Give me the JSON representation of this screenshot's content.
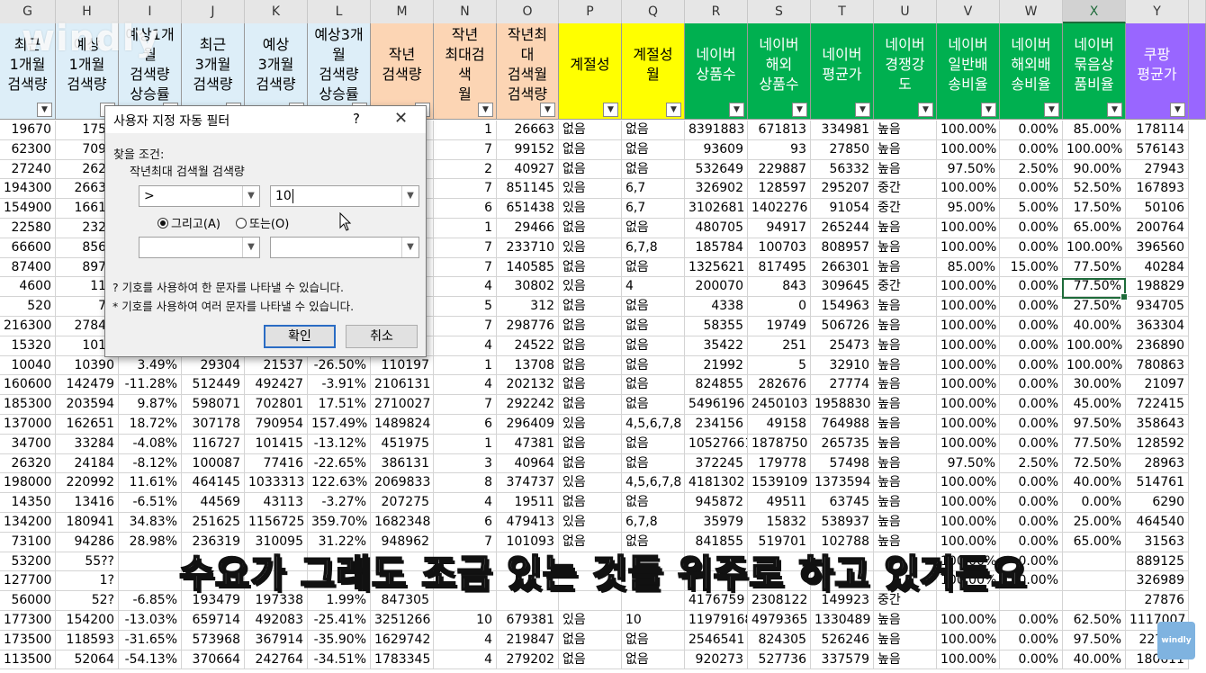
{
  "columns": [
    "G",
    "H",
    "I",
    "J",
    "K",
    "L",
    "M",
    "N",
    "O",
    "P",
    "Q",
    "R",
    "S",
    "T",
    "U",
    "V",
    "W",
    "X",
    "Y"
  ],
  "headers": [
    {
      "label": "최근\n1개월\n검색량",
      "color": "#ddeef8"
    },
    {
      "label": "예상\n1개월\n검색량",
      "color": "#ddeef8"
    },
    {
      "label": "예상1개월\n검색량\n상승률",
      "color": "#ddeef8"
    },
    {
      "label": "최근\n3개월\n검색량",
      "color": "#ddeef8"
    },
    {
      "label": "예상\n3개월\n검색량",
      "color": "#ddeef8"
    },
    {
      "label": "예상3개\n월\n검색량\n상승률",
      "color": "#ddeef8"
    },
    {
      "label": "작년\n검색량",
      "color": "#fcd5b4"
    },
    {
      "label": "작년\n최대검\n색\n월",
      "color": "#fcd5b4"
    },
    {
      "label": "작년최\n대\n검색월\n검색량",
      "color": "#fcd5b4"
    },
    {
      "label": "계절성",
      "color": "#ffff00"
    },
    {
      "label": "계절성\n월",
      "color": "#ffff00"
    },
    {
      "label": "네이버\n상품수",
      "color": "#00b050"
    },
    {
      "label": "네이버\n해외\n상품수",
      "color": "#00b050"
    },
    {
      "label": "네이버\n평균가",
      "color": "#00b050"
    },
    {
      "label": "네이버\n경쟁강\n도",
      "color": "#00b050"
    },
    {
      "label": "네이버\n일반배\n송비율",
      "color": "#00b050"
    },
    {
      "label": "네이버\n해외배\n송비율",
      "color": "#00b050"
    },
    {
      "label": "네이버\n묶음상\n품비율",
      "color": "#00b050"
    },
    {
      "label": "쿠팡\n평균가",
      "color": "#9966ff"
    }
  ],
  "rows": [
    [
      "19670",
      "1758",
      "",
      "",
      "",
      "",
      "",
      "1",
      "26663",
      "없음",
      "없음",
      "8391883",
      "671813",
      "334981",
      "높음",
      "100.00%",
      "0.00%",
      "85.00%",
      "178114"
    ],
    [
      "62300",
      "7098",
      "",
      "",
      "",
      "",
      "",
      "7",
      "99152",
      "없음",
      "없음",
      "93609",
      "93",
      "27850",
      "높음",
      "100.00%",
      "0.00%",
      "100.00%",
      "576143"
    ],
    [
      "27240",
      "2628",
      "",
      "",
      "",
      "",
      "",
      "2",
      "40927",
      "없음",
      "없음",
      "532649",
      "229887",
      "56332",
      "높음",
      "97.50%",
      "2.50%",
      "90.00%",
      "27943"
    ],
    [
      "194300",
      "26639",
      "",
      "",
      "",
      "",
      "",
      "7",
      "851145",
      "있음",
      "6,7",
      "326902",
      "128597",
      "295207",
      "중간",
      "100.00%",
      "0.00%",
      "52.50%",
      "167893"
    ],
    [
      "154900",
      "16613",
      "",
      "",
      "",
      "",
      "",
      "6",
      "651438",
      "있음",
      "6,7",
      "3102681",
      "1402276",
      "91054",
      "중간",
      "95.00%",
      "5.00%",
      "17.50%",
      "50106"
    ],
    [
      "22580",
      "2327",
      "",
      "",
      "",
      "",
      "",
      "1",
      "29466",
      "없음",
      "없음",
      "480705",
      "94917",
      "265244",
      "높음",
      "100.00%",
      "0.00%",
      "65.00%",
      "200764"
    ],
    [
      "66600",
      "8568",
      "",
      "",
      "",
      "",
      "",
      "7",
      "233710",
      "있음",
      "6,7,8",
      "185784",
      "100703",
      "808957",
      "높음",
      "100.00%",
      "0.00%",
      "100.00%",
      "396560"
    ],
    [
      "87400",
      "8976",
      "",
      "",
      "",
      "",
      "",
      "7",
      "140585",
      "없음",
      "없음",
      "1325621",
      "817495",
      "266301",
      "높음",
      "85.00%",
      "15.00%",
      "77.50%",
      "40284"
    ],
    [
      "4600",
      "114",
      "",
      "",
      "",
      "",
      "",
      "4",
      "30802",
      "있음",
      "4",
      "200070",
      "843",
      "309645",
      "중간",
      "100.00%",
      "0.00%",
      "77.50%",
      "198829"
    ],
    [
      "520",
      "72",
      "",
      "",
      "",
      "",
      "",
      "5",
      "312",
      "없음",
      "없음",
      "4338",
      "0",
      "154963",
      "높음",
      "100.00%",
      "0.00%",
      "27.50%",
      "934705"
    ],
    [
      "216300",
      "27842",
      "",
      "",
      "",
      "",
      "",
      "7",
      "298776",
      "없음",
      "없음",
      "58355",
      "19749",
      "506726",
      "높음",
      "100.00%",
      "0.00%",
      "40.00%",
      "363304"
    ],
    [
      "15320",
      "1017",
      "",
      "",
      "",
      "",
      "",
      "4",
      "24522",
      "없음",
      "없음",
      "35422",
      "251",
      "25473",
      "높음",
      "100.00%",
      "0.00%",
      "100.00%",
      "236890"
    ],
    [
      "10040",
      "10390",
      "3.49%",
      "29304",
      "21537",
      "-26.50%",
      "110197",
      "1",
      "13708",
      "없음",
      "없음",
      "21992",
      "5",
      "32910",
      "높음",
      "100.00%",
      "0.00%",
      "100.00%",
      "780863"
    ],
    [
      "160600",
      "142479",
      "-11.28%",
      "512449",
      "492427",
      "-3.91%",
      "2106131",
      "4",
      "202132",
      "없음",
      "없음",
      "824855",
      "282676",
      "27774",
      "높음",
      "100.00%",
      "0.00%",
      "30.00%",
      "21097"
    ],
    [
      "185300",
      "203594",
      "9.87%",
      "598071",
      "702801",
      "17.51%",
      "2710027",
      "7",
      "292242",
      "없음",
      "없음",
      "5496196",
      "2450103",
      "1958830",
      "높음",
      "100.00%",
      "0.00%",
      "45.00%",
      "722415"
    ],
    [
      "137000",
      "162651",
      "18.72%",
      "307178",
      "790954",
      "157.49%",
      "1489824",
      "6",
      "296409",
      "있음",
      "4,5,6,7,8",
      "234156",
      "49158",
      "764988",
      "높음",
      "100.00%",
      "0.00%",
      "97.50%",
      "358643"
    ],
    [
      "34700",
      "33284",
      "-4.08%",
      "116727",
      "101415",
      "-13.12%",
      "451975",
      "1",
      "47381",
      "없음",
      "없음",
      "10527661",
      "1878750",
      "265735",
      "높음",
      "100.00%",
      "0.00%",
      "77.50%",
      "128592"
    ],
    [
      "26320",
      "24184",
      "-8.12%",
      "100087",
      "77416",
      "-22.65%",
      "386131",
      "3",
      "40964",
      "없음",
      "없음",
      "372245",
      "179778",
      "57498",
      "높음",
      "97.50%",
      "2.50%",
      "72.50%",
      "28963"
    ],
    [
      "198000",
      "220992",
      "11.61%",
      "464145",
      "1033313",
      "122.63%",
      "2069833",
      "8",
      "374737",
      "있음",
      "4,5,6,7,8",
      "4181302",
      "1539109",
      "1373594",
      "높음",
      "100.00%",
      "0.00%",
      "40.00%",
      "514761"
    ],
    [
      "14350",
      "13416",
      "-6.51%",
      "44569",
      "43113",
      "-3.27%",
      "207275",
      "4",
      "19511",
      "없음",
      "없음",
      "945872",
      "49511",
      "63745",
      "높음",
      "100.00%",
      "0.00%",
      "0.00%",
      "6290"
    ],
    [
      "134200",
      "180941",
      "34.83%",
      "251625",
      "1156725",
      "359.70%",
      "1682348",
      "6",
      "479413",
      "있음",
      "6,7,8",
      "35979",
      "15832",
      "538937",
      "높음",
      "100.00%",
      "0.00%",
      "25.00%",
      "464540"
    ],
    [
      "73100",
      "94286",
      "28.98%",
      "236319",
      "310095",
      "31.22%",
      "948962",
      "7",
      "101093",
      "없음",
      "없음",
      "841855",
      "519701",
      "102788",
      "높음",
      "100.00%",
      "0.00%",
      "65.00%",
      "31563"
    ],
    [
      "53200",
      "55??",
      "",
      "",
      "",
      "",
      "",
      "",
      "",
      "",
      "",
      "",
      "",
      "",
      "",
      "100.00%",
      "0.00%",
      "",
      "889125"
    ],
    [
      "127700",
      "1?",
      "",
      "57",
      "",
      "",
      "",
      "",
      "",
      "",
      "",
      "",
      "",
      "",
      "",
      "100.00%",
      "0.00%",
      "",
      "326989"
    ],
    [
      "56000",
      "52?",
      "-6.85%",
      "193479",
      "197338",
      "1.99%",
      "847305",
      "",
      "",
      "",
      "",
      "4176759",
      "2308122",
      "149923",
      "중간",
      "",
      "",
      "",
      "27876"
    ],
    [
      "177300",
      "154200",
      "-13.03%",
      "659714",
      "492083",
      "-25.41%",
      "3251266",
      "10",
      "679381",
      "있음",
      "10",
      "11979168",
      "4979365",
      "1330489",
      "높음",
      "100.00%",
      "0.00%",
      "62.50%",
      "1117007"
    ],
    [
      "173500",
      "118593",
      "-31.65%",
      "573968",
      "367914",
      "-35.90%",
      "1629742",
      "4",
      "219847",
      "없음",
      "없음",
      "2546541",
      "824305",
      "526246",
      "높음",
      "100.00%",
      "0.00%",
      "97.50%",
      "22??00"
    ],
    [
      "113500",
      "52064",
      "-54.13%",
      "370664",
      "242764",
      "-34.51%",
      "1783345",
      "4",
      "279202",
      "없음",
      "없음",
      "920273",
      "527736",
      "337579",
      "높음",
      "100.00%",
      "0.00%",
      "40.00%",
      "180611"
    ]
  ],
  "dialog": {
    "title": "사용자 지정 자동 필터",
    "help": "?",
    "close": "✕",
    "find_label": "찾을 조건:",
    "field_label": "작년최대 검색월 검색량",
    "op1": ">",
    "val1": "10",
    "op2": "",
    "val2": "",
    "and_label": "그리고(A)",
    "or_label": "또는(O)",
    "and_selected": true,
    "hint1": "? 기호를 사용하여 한 문자를 나타낼 수 있습니다.",
    "hint2": "* 기호를 사용하여 여러 문자를 나타낼 수 있습니다.",
    "ok": "확인",
    "cancel": "취소"
  },
  "watermark": "windly",
  "subtitle": "수요가 그래도 조금 있는 것들 위주로 하고 있거든요",
  "badge": "windly"
}
